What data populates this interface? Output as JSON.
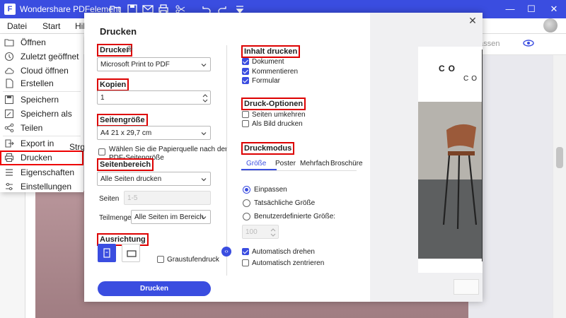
{
  "app": {
    "title": "Wondershare PDFelement"
  },
  "menubar": {
    "items": [
      "Datei",
      "Start",
      "Hil"
    ]
  },
  "toolbar": {
    "permit_text": "ubearbeitung zulassen zulassen"
  },
  "file_menu": {
    "items": [
      {
        "label": "Öffnen",
        "icon": "folder-open-icon"
      },
      {
        "label": "Zuletzt geöffnet",
        "icon": "clock-icon"
      },
      {
        "label": "Cloud öffnen",
        "icon": "cloud-icon"
      },
      {
        "label": "Erstellen",
        "icon": "document-icon"
      },
      {
        "label": "Speichern",
        "icon": "save-icon"
      },
      {
        "label": "Speichern als",
        "icon": "save-as-icon"
      },
      {
        "label": "Teilen",
        "icon": "share-icon"
      },
      {
        "label": "Export in",
        "icon": "export-icon"
      },
      {
        "label": "Drucken",
        "icon": "print-icon"
      },
      {
        "label": "Eigenschaften",
        "icon": "list-icon"
      },
      {
        "label": "Einstellungen",
        "icon": "sliders-icon"
      }
    ],
    "selected": "Drucken",
    "extra": "Strg"
  },
  "dialog": {
    "title": "Drucken",
    "printer": {
      "label": "Drucker",
      "value": "Microsoft Print to PDF"
    },
    "copies": {
      "label": "Kopien",
      "value": "1"
    },
    "page_size": {
      "label": "Seitengröße",
      "value": "A4 21 x 29,7 cm",
      "checkbox_label_1": "Wählen Sie die Papierquelle nach der",
      "checkbox_label_2": "PDF-Seitengröße",
      "checked": false
    },
    "page_range": {
      "label": "Seitenbereich",
      "value": "Alle Seiten drucken",
      "pages_label": "Seiten",
      "pages_placeholder": "1-5",
      "subset_label": "Teilmenge",
      "subset_value": "Alle Seiten im Bereich"
    },
    "orientation": {
      "label": "Ausrichtung",
      "selected": "portrait",
      "grayscale_label": "Graustufendruck",
      "grayscale_checked": false
    },
    "print_button": "Drucken",
    "content": {
      "label": "Inhalt drucken",
      "items": [
        {
          "label": "Dokument",
          "checked": true
        },
        {
          "label": "Kommentieren",
          "checked": true
        },
        {
          "label": "Formular",
          "checked": true
        }
      ]
    },
    "options": {
      "label": "Druck-Optionen",
      "items": [
        {
          "label": "Seiten umkehren",
          "checked": false
        },
        {
          "label": "Als Bild drucken",
          "checked": false
        }
      ]
    },
    "mode": {
      "label": "Druckmodus",
      "tabs": [
        "Größe",
        "Poster",
        "Mehrfach",
        "Broschüre"
      ],
      "active_tab": "Größe",
      "radios": [
        {
          "label": "Einpassen",
          "checked": true
        },
        {
          "label": "Tatsächliche Größe",
          "checked": false
        },
        {
          "label": "Benutzerdefinierte Größe:",
          "checked": false
        }
      ],
      "custom_value": "100",
      "auto_rotate": {
        "label": "Automatisch drehen",
        "checked": true
      },
      "auto_center": {
        "label": "Automatisch zentrieren",
        "checked": false
      }
    },
    "preview": {
      "title1": "CO",
      "title2": "CO"
    }
  }
}
